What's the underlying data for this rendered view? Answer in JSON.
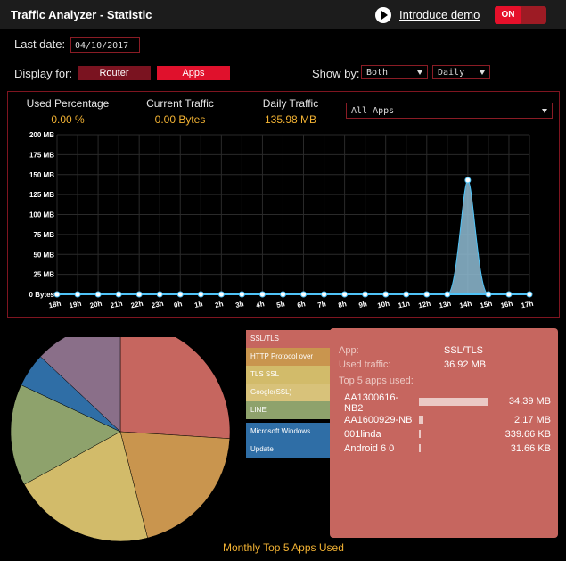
{
  "header": {
    "title": "Traffic Analyzer - Statistic",
    "demo_link": "Introduce demo",
    "toggle": "ON"
  },
  "filters": {
    "last_date_label": "Last date:",
    "last_date_value": "04/10/2017",
    "display_for_label": "Display for:",
    "display_router": "Router",
    "display_apps": "Apps",
    "show_by_label": "Show by:",
    "show_by_value": "Both",
    "period_value": "Daily"
  },
  "stats": {
    "used_percentage_label": "Used Percentage",
    "used_percentage_value": "0.00 %",
    "current_traffic_label": "Current Traffic",
    "current_traffic_value": "0.00 Bytes",
    "daily_traffic_label": "Daily Traffic",
    "daily_traffic_value": "135.98 MB",
    "app_filter": "All Apps"
  },
  "chart_data": {
    "type": "area",
    "title": "",
    "ylabel": "",
    "xlabel": "",
    "ylim": [
      0,
      200
    ],
    "y_ticks": [
      "0 Bytes",
      "25 MB",
      "50 MB",
      "75 MB",
      "100 MB",
      "125 MB",
      "150 MB",
      "175 MB",
      "200 MB"
    ],
    "x": [
      "18h",
      "19h",
      "20h",
      "21h",
      "22h",
      "23h",
      "0h",
      "1h",
      "2h",
      "3h",
      "4h",
      "5h",
      "6h",
      "7h",
      "8h",
      "9h",
      "10h",
      "11h",
      "12h",
      "13h",
      "14h",
      "15h",
      "16h",
      "17h"
    ],
    "series": [
      {
        "values": [
          0,
          0,
          0,
          0,
          0,
          0,
          0,
          0,
          0,
          0,
          0,
          0,
          0,
          0,
          0,
          0,
          0,
          0,
          0,
          0,
          143,
          0,
          0,
          0
        ]
      }
    ],
    "grid": true,
    "line_color": "#4fc3f7",
    "fill_color": "#8fbcd4"
  },
  "pie": {
    "caption": "Monthly Top 5 Apps Used",
    "slices": [
      {
        "label": "SSL/TLS",
        "value": 26,
        "color": "#c6665f"
      },
      {
        "label": "HTTP Protocol over",
        "value": 20,
        "color": "#c9954e"
      },
      {
        "label": "TLS SSL",
        "value": 21,
        "color": "#d2bb6a"
      },
      {
        "label": "Google(SSL)",
        "value": 15,
        "color": "#8ea26c"
      },
      {
        "label": "LINE",
        "value": 5,
        "color": "#2f6ea6"
      },
      {
        "label": "Microsoft Windows Update",
        "value": 13,
        "color": "#8a6f89"
      }
    ],
    "legend": [
      "SSL/TLS",
      "HTTP Protocol over",
      "TLS SSL",
      "Google(SSL)",
      "LINE",
      "Microsoft Windows",
      "Update"
    ]
  },
  "detail": {
    "app_label": "App:",
    "app_value": "SSL/TLS",
    "traffic_label": "Used traffic:",
    "traffic_value": "36.92 MB",
    "top_label": "Top 5 apps used:",
    "users": [
      {
        "name1": "AA1300616-",
        "name2": "NB2",
        "amount": "34.39 MB",
        "share": 0.94
      },
      {
        "name1": "AA1600929-NB",
        "name2": "",
        "amount": "2.17 MB",
        "share": 0.06
      },
      {
        "name1": "001linda",
        "name2": "",
        "amount": "339.66 KB",
        "share": 0.01
      },
      {
        "name1": "Android 6 0",
        "name2": "",
        "amount": "31.66 KB",
        "share": 0.001
      }
    ]
  }
}
